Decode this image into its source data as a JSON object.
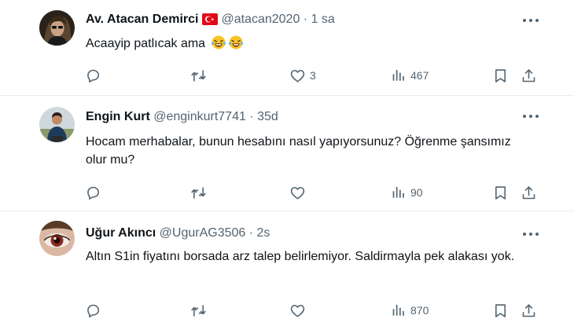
{
  "tweets": [
    {
      "name": "Av. Atacan Demirci",
      "handle": "@atacan2020",
      "dot": "·",
      "time": "1 sa",
      "text": "Acaayip patlıcak ama",
      "likes": "3",
      "views": "467",
      "replies": "",
      "retweets": ""
    },
    {
      "name": "Engin Kurt",
      "handle": "@enginkurt7741",
      "dot": "·",
      "time": "35d",
      "text": "Hocam merhabalar, bunun hesabını nasıl yapıyorsunuz? Öğrenme şansımız olur mu?",
      "likes": "",
      "views": "90",
      "replies": "",
      "retweets": ""
    },
    {
      "name": "Uğur Akıncı",
      "handle": "@UgurAG3506",
      "dot": "·",
      "time": "2s",
      "text": "Altın S1in fiyatını borsada arz talep belirlemiyor. Saldirmayla pek alakası yok.",
      "likes": "",
      "views": "870",
      "replies": "",
      "retweets": ""
    }
  ],
  "icons": {
    "reply": "reply-icon",
    "retweet": "retweet-icon",
    "like": "heart-icon",
    "views": "views-icon",
    "bookmark": "bookmark-icon",
    "share": "share-icon",
    "more": "more-icon",
    "flag": "turkey-flag-icon",
    "emoji": "tears-of-joy-emoji"
  },
  "colors": {
    "text": "#0f1419",
    "secondary": "#536471",
    "divider": "#e6ecf0",
    "flag_red": "#e30a17"
  }
}
